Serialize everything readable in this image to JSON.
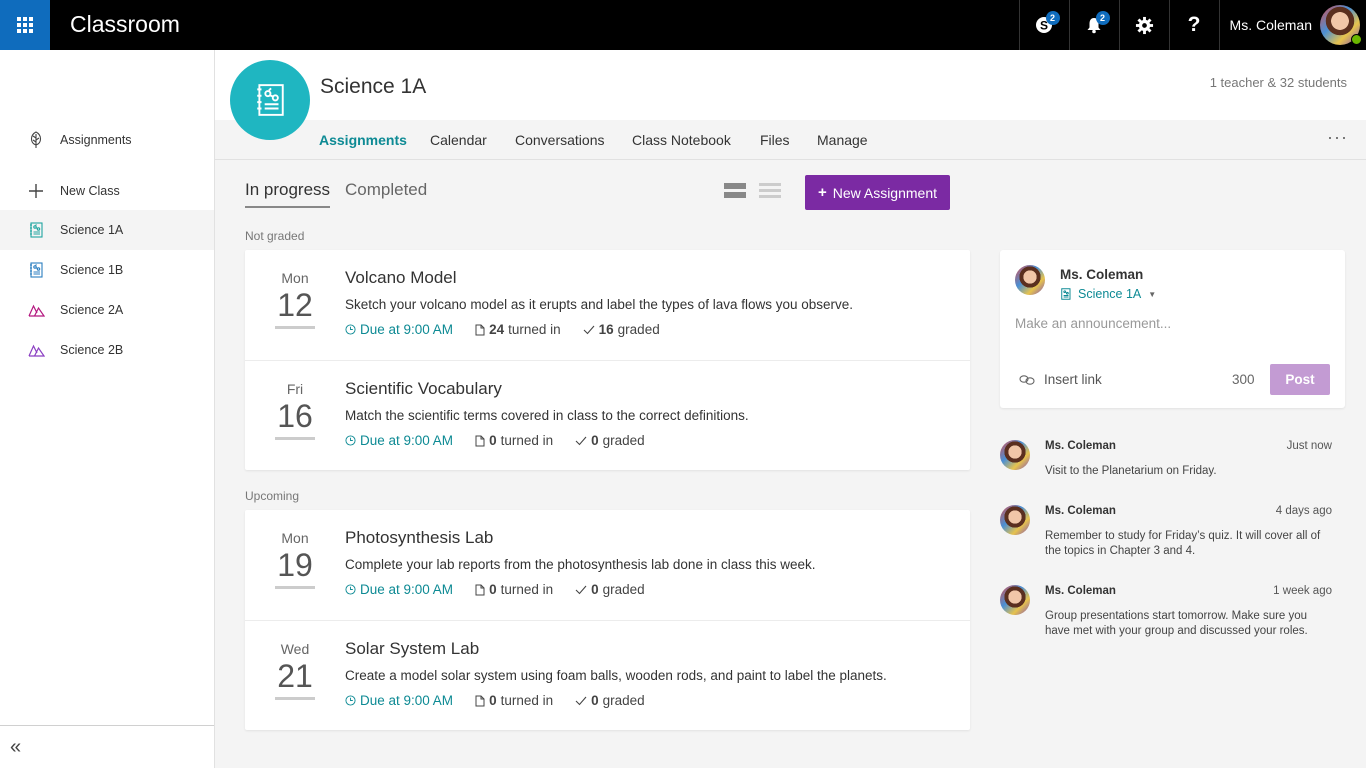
{
  "app": {
    "title": "Classroom",
    "skype_badge": "2",
    "notifications_badge": "2",
    "user_name": "Ms. Coleman"
  },
  "colors": {
    "brand_blue": "#0f6cbd",
    "accent_teal": "#0d8a94",
    "class_circle": "#1fb6c1",
    "primary_button": "#7b2aa3",
    "post_button_disabled": "#c39bd3",
    "presence_online": "#6bb700"
  },
  "icons": {
    "app_launcher": "waffle-icon",
    "skype": "skype-icon",
    "notifications": "bell-icon",
    "settings": "gear-icon",
    "help": "question-icon",
    "assignments": "leaf-icon",
    "new_class": "plus-icon",
    "notebook_class": "notebook-icon",
    "mountain_class": "mountain-icon",
    "collapse": "double-chevron-left-icon",
    "due": "clock-icon",
    "turned_in": "document-icon",
    "graded": "check-icon",
    "insert_link": "link-icon"
  },
  "sidebar": {
    "assignments_label": "Assignments",
    "new_class_label": "New Class",
    "classes": [
      {
        "label": "Science 1A",
        "icon": "notebook-icon",
        "color": "#1fa5a0",
        "active": true
      },
      {
        "label": "Science 1B",
        "icon": "notebook-icon",
        "color": "#2a7ec0",
        "active": false
      },
      {
        "label": "Science 2A",
        "icon": "mountain-icon",
        "color": "#b4187f",
        "active": false
      },
      {
        "label": "Science 2B",
        "icon": "mountain-icon",
        "color": "#8b3fc2",
        "active": false
      }
    ],
    "collapse_glyph": "«"
  },
  "class_header": {
    "name": "Science 1A",
    "members": "1 teacher & 32 students",
    "tabs": [
      "Assignments",
      "Calendar",
      "Conversations",
      "Class Notebook",
      "Files",
      "Manage"
    ],
    "active_tab": "Assignments",
    "more_glyph": "···"
  },
  "assignments_view": {
    "filter_tabs": [
      "In progress",
      "Completed"
    ],
    "active_filter": "In progress",
    "new_button_label": "New Assignment",
    "new_button_glyph": "+",
    "sections": [
      {
        "label": "Not graded",
        "items": [
          {
            "day": "Mon",
            "date": "12",
            "title": "Volcano Model",
            "description": "Sketch your volcano model as it erupts and label the types of lava flows you observe.",
            "due": "Due at 9:00 AM",
            "turned_in_count": "24",
            "turned_in_label": "turned in",
            "graded_count": "16",
            "graded_label": "graded"
          },
          {
            "day": "Fri",
            "date": "16",
            "title": "Scientific Vocabulary",
            "description": "Match the scientific terms covered in class to the correct definitions.",
            "due": "Due at 9:00 AM",
            "turned_in_count": "0",
            "turned_in_label": "turned in",
            "graded_count": "0",
            "graded_label": "graded"
          }
        ]
      },
      {
        "label": "Upcoming",
        "items": [
          {
            "day": "Mon",
            "date": "19",
            "title": "Photosynthesis Lab",
            "description": "Complete your lab reports from the photosynthesis lab done in class this week.",
            "due": "Due at 9:00 AM",
            "turned_in_count": "0",
            "turned_in_label": "turned in",
            "graded_count": "0",
            "graded_label": "graded"
          },
          {
            "day": "Wed",
            "date": "21",
            "title": "Solar System Lab",
            "description": "Create a model solar system using foam balls, wooden rods, and paint to label the planets.",
            "due": "Due at 9:00 AM",
            "turned_in_count": "0",
            "turned_in_label": "turned in",
            "graded_count": "0",
            "graded_label": "graded"
          }
        ]
      }
    ]
  },
  "composer": {
    "author": "Ms. Coleman",
    "class_selector": "Science 1A",
    "placeholder": "Make an announcement...",
    "insert_link_label": "Insert link",
    "char_count": "300",
    "post_label": "Post"
  },
  "feed": [
    {
      "author": "Ms. Coleman",
      "time": "Just now",
      "text": "Visit to the Planetarium on Friday."
    },
    {
      "author": "Ms. Coleman",
      "time": "4 days ago",
      "text": "Remember to study for Friday’s quiz. It will cover all of the topics in Chapter 3 and 4."
    },
    {
      "author": "Ms. Coleman",
      "time": "1 week ago",
      "text": "Group presentations start tomorrow. Make sure you have met with your group and discussed your roles."
    }
  ]
}
